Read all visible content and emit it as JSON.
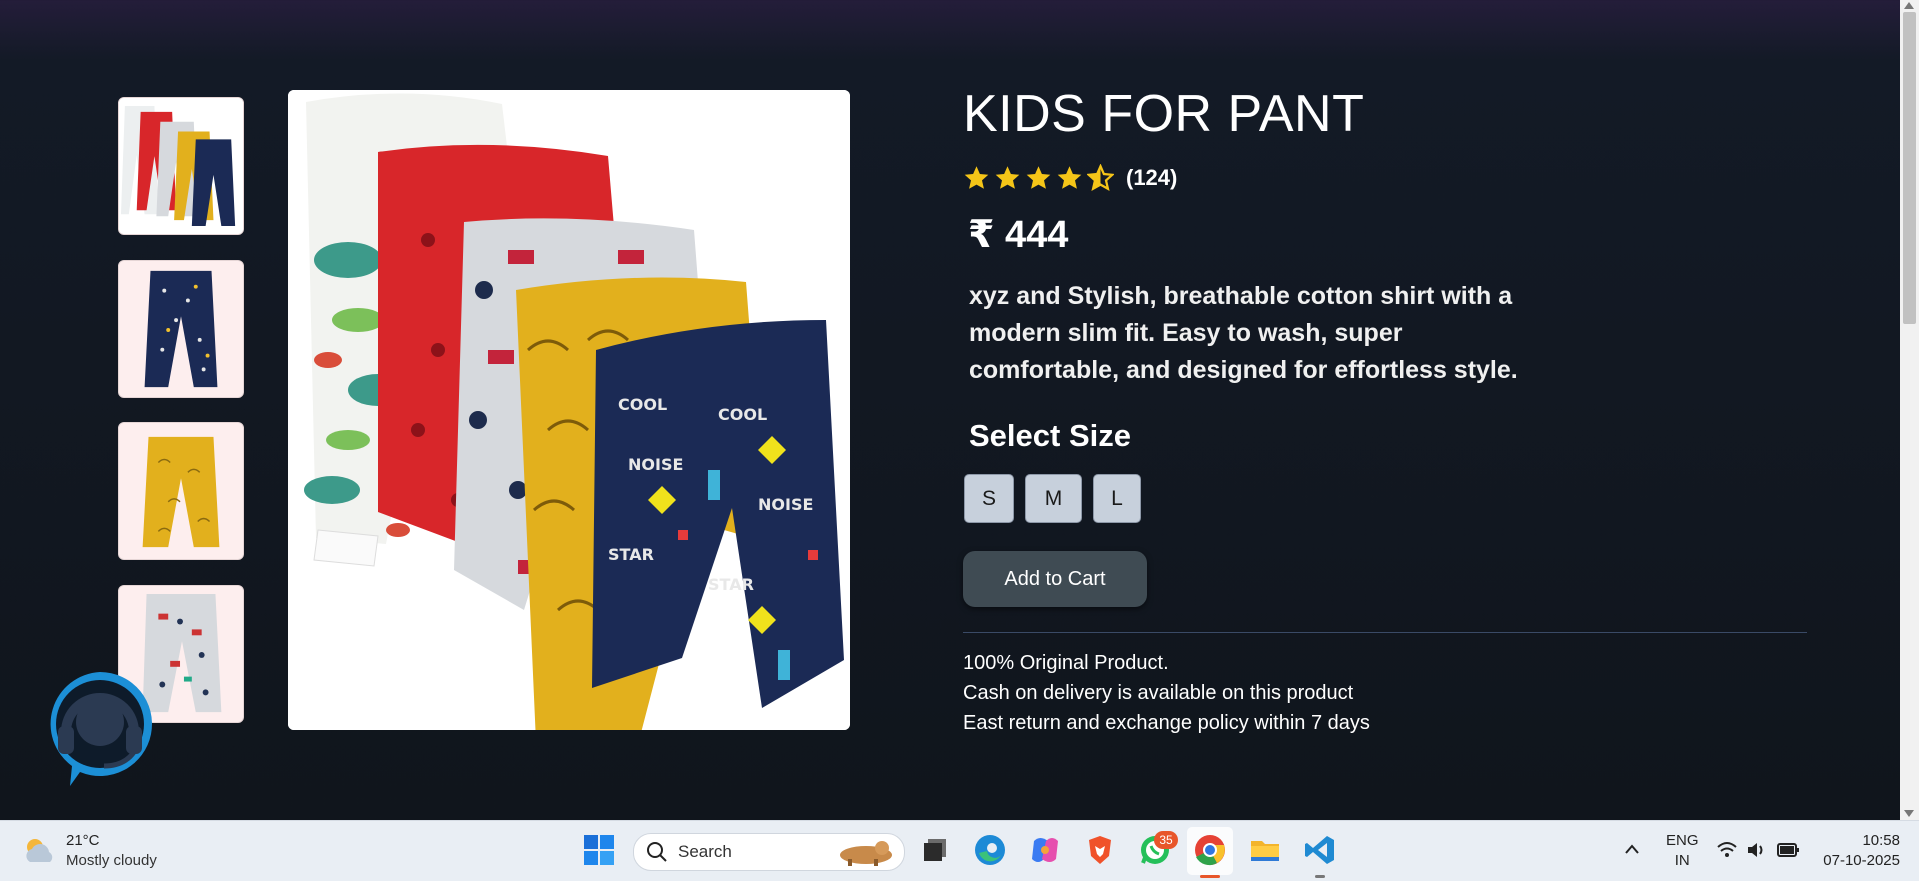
{
  "product": {
    "title": "KIDS FOR PANT",
    "rating": 4.5,
    "rating_count": "(124)",
    "price": "₹ 444",
    "description": "xyz and Stylish, breathable cotton shirt with a modern slim fit. Easy to wash, super comfortable, and designed for effortless style.",
    "select_size_label": "Select Size",
    "sizes": [
      "S",
      "M",
      "L"
    ],
    "add_to_cart_label": "Add to Cart",
    "policies": [
      "100% Original Product.",
      "Cash on delivery is available on this product",
      "East return and exchange policy within 7 days"
    ]
  },
  "gallery": {
    "thumbnail_icons": [
      "five-pants-pack-image",
      "navy-pant-image",
      "yellow-pant-image",
      "grey-pant-image"
    ],
    "main_image": "five-pants-pack-image"
  },
  "support_icon": "headset-chat-icon",
  "colors": {
    "star": "#f5c518",
    "cart_button": "#3f4b53",
    "size_button": "#c7d0dc"
  },
  "taskbar": {
    "weather_temp": "21°C",
    "weather_desc": "Mostly cloudy",
    "search_label": "Search",
    "whatsapp_badge": "35",
    "lang_line1": "ENG",
    "lang_line2": "IN",
    "time": "10:58",
    "date": "07-10-2025",
    "apps": [
      "windows-start-icon",
      "task-view-icon",
      "edge-icon",
      "copilot-icon",
      "brave-icon",
      "whatsapp-icon",
      "chrome-icon",
      "file-explorer-icon",
      "vscode-icon"
    ]
  }
}
